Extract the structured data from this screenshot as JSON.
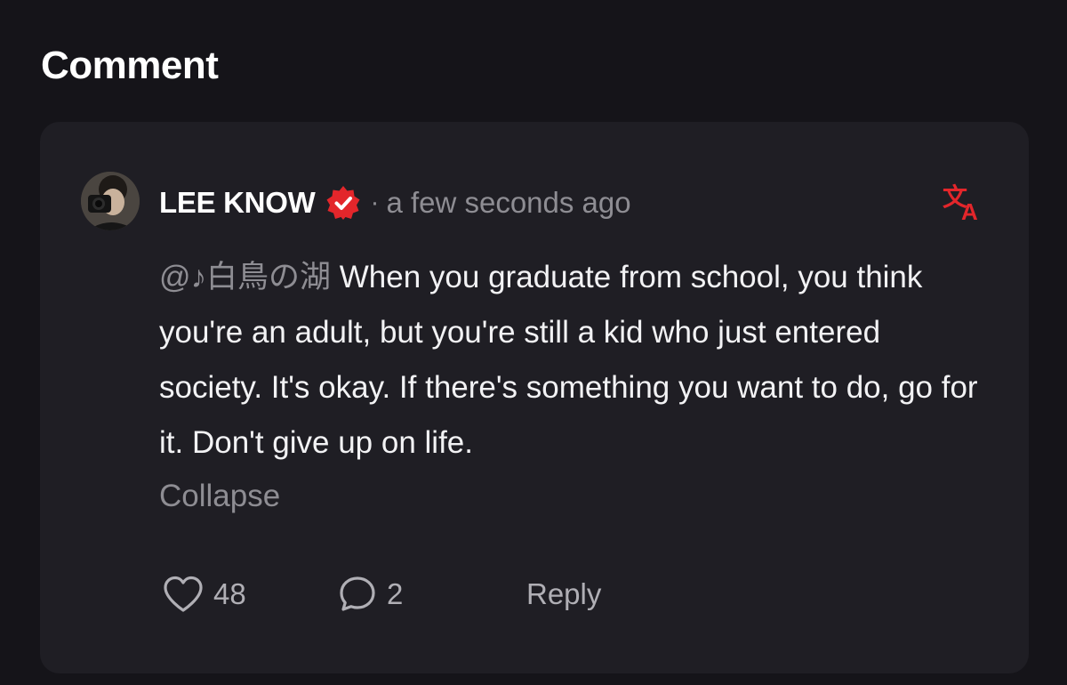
{
  "section": {
    "title": "Comment"
  },
  "comment": {
    "username": "LEE KNOW",
    "separator": "·",
    "timestamp": "a few seconds ago",
    "mention": "@♪白鳥の湖",
    "text": "When you graduate from school, you think you're an adult, but you're still a kid who just entered society. It's okay. If there's something you want to do, go for it. Don't give up on life.",
    "collapse_label": "Collapse",
    "likes": "48",
    "replies": "2",
    "reply_label": "Reply"
  },
  "icons": {
    "avatar": "user-avatar",
    "verified": "verified-badge-icon",
    "translate": "translate-icon",
    "like": "heart-icon",
    "comment": "comment-bubble-icon"
  },
  "colors": {
    "background": "#151419",
    "card": "#1f1e24",
    "accent_red": "#e3262b",
    "muted_text": "#8e8d93"
  }
}
